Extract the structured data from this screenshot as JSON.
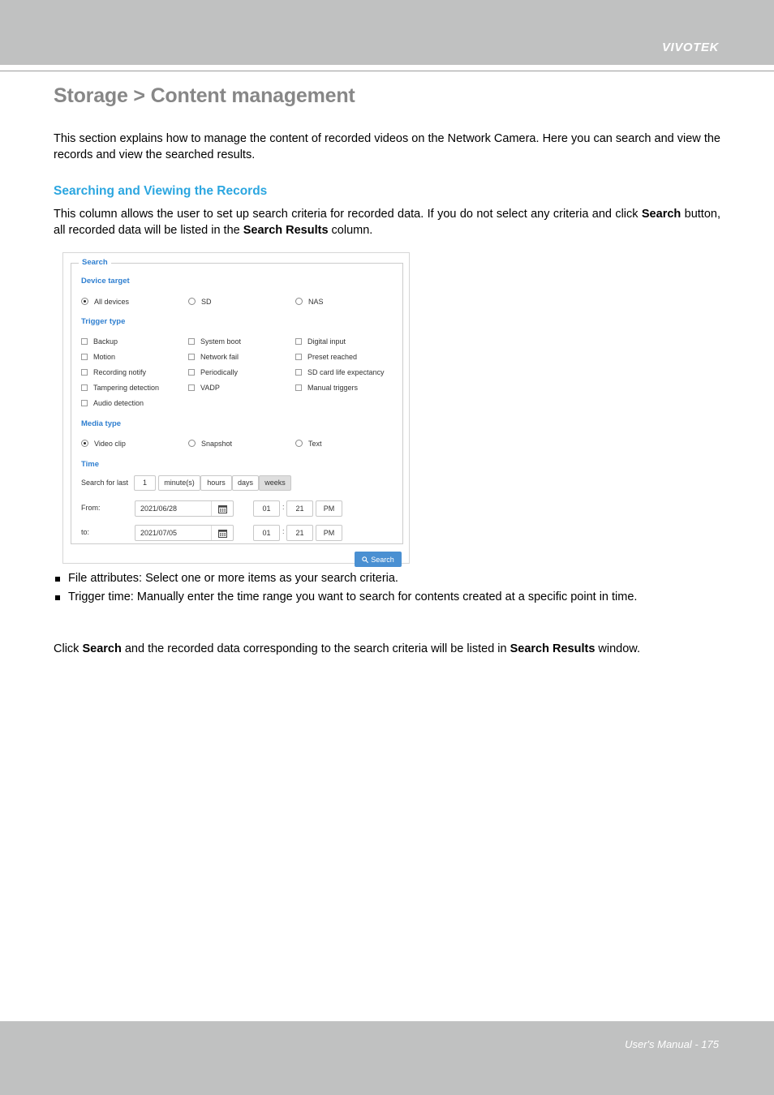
{
  "header": {
    "brand": "VIVOTEK"
  },
  "page": {
    "title": "Storage > Content management",
    "intro": "This section explains how to manage the content of recorded videos on the Network Camera. Here you can search and view the records and view the searched results.",
    "section_heading": "Searching and Viewing the Records",
    "section_intro_1": "This column allows the user to set up search criteria for recorded data. If you do not select any criteria and click ",
    "section_intro_bold_1": "Search",
    "section_intro_2": " button, all recorded data will be listed in the ",
    "section_intro_bold_2": "Search Results",
    "section_intro_3": " column."
  },
  "panel": {
    "legend": "Search",
    "device_target": {
      "label": "Device target",
      "options": [
        {
          "label": "All devices",
          "selected": true
        },
        {
          "label": "SD",
          "selected": false
        },
        {
          "label": "NAS",
          "selected": false
        }
      ]
    },
    "trigger_type": {
      "label": "Trigger type",
      "options": [
        {
          "label": "Backup",
          "checked": false
        },
        {
          "label": "System boot",
          "checked": false
        },
        {
          "label": "Digital input",
          "checked": false
        },
        {
          "label": "Motion",
          "checked": false
        },
        {
          "label": "Network fail",
          "checked": false
        },
        {
          "label": "Preset reached",
          "checked": false
        },
        {
          "label": "Recording notify",
          "checked": false
        },
        {
          "label": "Periodically",
          "checked": false
        },
        {
          "label": "SD card life expectancy",
          "checked": false
        },
        {
          "label": "Tampering detection",
          "checked": false
        },
        {
          "label": "VADP",
          "checked": false
        },
        {
          "label": "Manual triggers",
          "checked": false
        },
        {
          "label": "Audio detection",
          "checked": false
        }
      ]
    },
    "media_type": {
      "label": "Media type",
      "options": [
        {
          "label": "Video clip",
          "selected": true
        },
        {
          "label": "Snapshot",
          "selected": false
        },
        {
          "label": "Text",
          "selected": false
        }
      ]
    },
    "time": {
      "label": "Time",
      "search_for_last_label": "Search for last",
      "amount": "1",
      "units": [
        {
          "label": "minute(s)",
          "active": false
        },
        {
          "label": "hours",
          "active": false
        },
        {
          "label": "days",
          "active": false
        },
        {
          "label": "weeks",
          "active": true
        }
      ],
      "from_label": "From:",
      "from_date": "2021/06/28",
      "from_hour": "01",
      "from_minute": "21",
      "from_meridiem": "PM",
      "to_label": "to:",
      "to_date": "2021/07/05",
      "to_hour": "01",
      "to_minute": "21",
      "to_meridiem": "PM",
      "time_separator": ":"
    },
    "search_button": "Search"
  },
  "bullets": [
    "File attributes: Select one or more items as your search criteria.",
    "Trigger time: Manually enter the time range you want to search for contents created at a specific point in time."
  ],
  "closing": {
    "part1": "Click ",
    "bold1": "Search",
    "part2": " and the recorded data corresponding to the search criteria will be listed in ",
    "bold2": "Search Results",
    "part3": " window."
  },
  "footer": {
    "text": "User's Manual - 175"
  },
  "colors": {
    "header_band": "#c0c1c1",
    "title_gray": "#878787",
    "heading_blue": "#2ba6e0",
    "panel_label_blue": "#2f7fd0",
    "button_blue": "#4a90d2"
  }
}
